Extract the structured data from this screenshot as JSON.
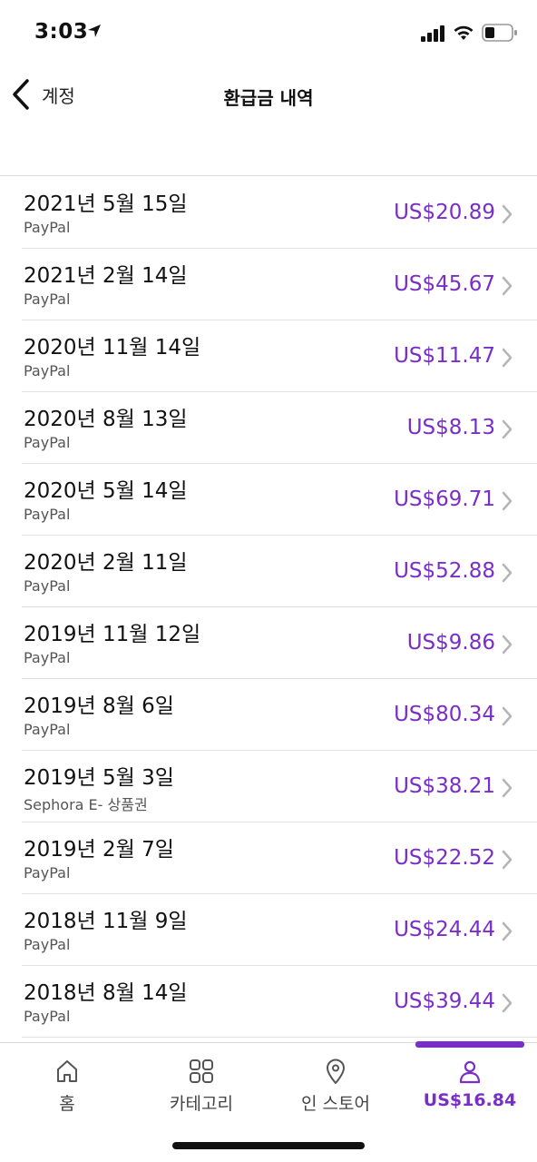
{
  "status": {
    "time": "3:03"
  },
  "nav": {
    "back_label": "계정",
    "title": "환급금 내역"
  },
  "refunds": [
    {
      "date": "2021년 5월 15일",
      "method": "PayPal",
      "amount": "US$20.89"
    },
    {
      "date": "2021년 2월 14일",
      "method": "PayPal",
      "amount": "US$45.67"
    },
    {
      "date": "2020년 11월 14일",
      "method": "PayPal",
      "amount": "US$11.47"
    },
    {
      "date": "2020년 8월 13일",
      "method": "PayPal",
      "amount": "US$8.13"
    },
    {
      "date": "2020년 5월 14일",
      "method": "PayPal",
      "amount": "US$69.71"
    },
    {
      "date": "2020년 2월 11일",
      "method": "PayPal",
      "amount": "US$52.88"
    },
    {
      "date": "2019년 11월 12일",
      "method": "PayPal",
      "amount": "US$9.86"
    },
    {
      "date": "2019년 8월 6일",
      "method": "PayPal",
      "amount": "US$80.34"
    },
    {
      "date": "2019년 5월 3일",
      "method": "Sephora E- 상품권",
      "amount": "US$38.21"
    },
    {
      "date": "2019년 2월 7일",
      "method": "PayPal",
      "amount": "US$22.52"
    },
    {
      "date": "2018년 11월 9일",
      "method": "PayPal",
      "amount": "US$24.44"
    },
    {
      "date": "2018년 8월 14일",
      "method": "PayPal",
      "amount": "US$39.44"
    }
  ],
  "tabs": [
    {
      "label": "홈",
      "icon": "home-icon"
    },
    {
      "label": "카테고리",
      "icon": "grid-icon"
    },
    {
      "label": "인 스토어",
      "icon": "location-pin-icon"
    },
    {
      "label": "US$16.84",
      "icon": "profile-icon",
      "active": true
    }
  ],
  "colors": {
    "accent": "#7a2ec8",
    "text": "#111111",
    "secondary_text": "#555555",
    "divider": "#e2e2e2"
  }
}
